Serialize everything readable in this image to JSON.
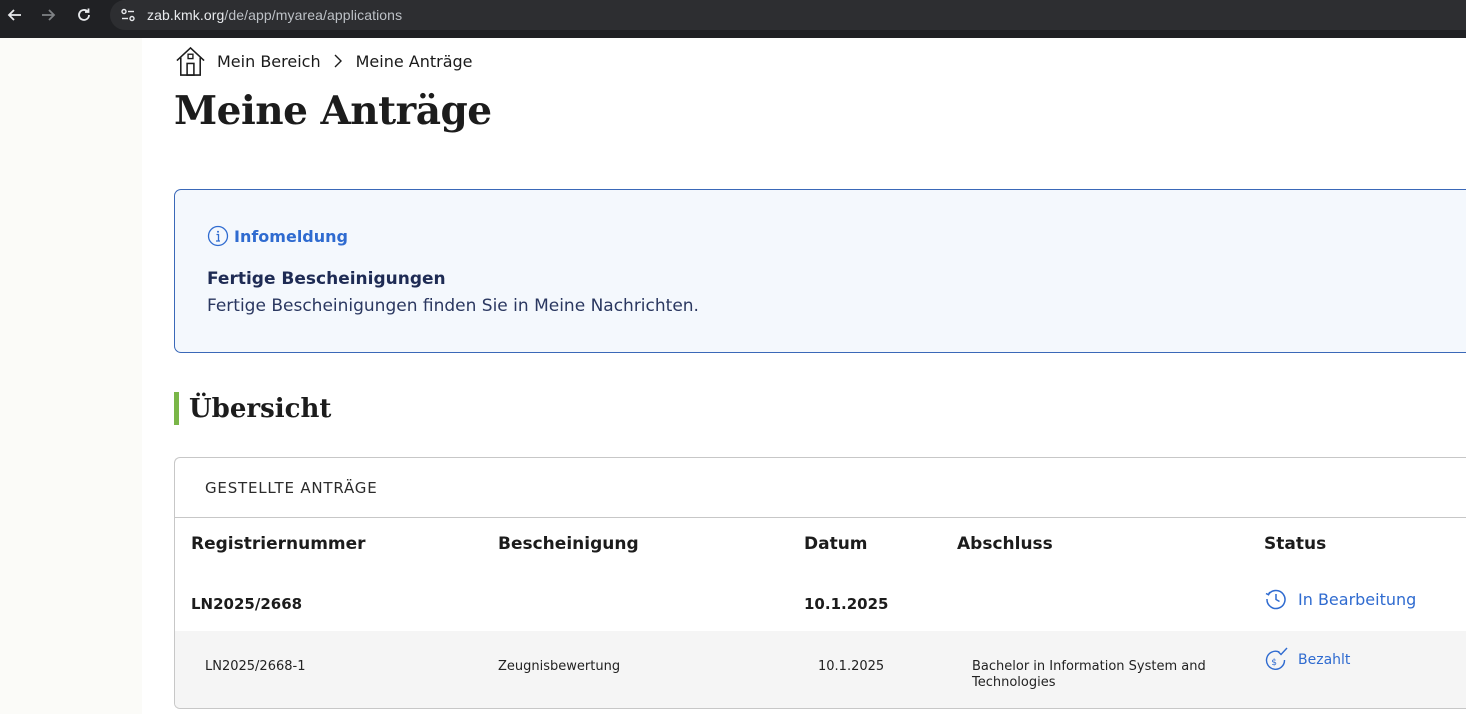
{
  "browser": {
    "url_host": "zab.kmk.org",
    "url_path": "/de/app/myarea/applications"
  },
  "breadcrumb": {
    "items": [
      "Mein Bereich",
      "Meine Anträge"
    ]
  },
  "page_title": "Meine Anträge",
  "info": {
    "label": "Infomeldung",
    "title": "Fertige Bescheinigungen",
    "text": "Fertige Bescheinigungen finden Sie in Meine Nachrichten."
  },
  "overview": {
    "title": "Übersicht",
    "card_title": "GESTELLTE ANTRÄGE",
    "columns": [
      "Registriernummer",
      "Bescheinigung",
      "Datum",
      "Abschluss",
      "Status"
    ],
    "main_row": {
      "registration": "LN2025/2668",
      "certificate": "",
      "date": "10.1.2025",
      "degree": "",
      "status": "In Bearbeitung"
    },
    "sub_row": {
      "registration": "LN2025/2668-1",
      "certificate": "Zeugnisbewertung",
      "date": "10.1.2025",
      "degree": "Bachelor in Information System and Technologies",
      "status": "Bezahlt"
    }
  },
  "colors": {
    "accent_blue": "#2f6bd0",
    "section_bar_green": "#7ab648",
    "info_border": "#3a68b8"
  }
}
